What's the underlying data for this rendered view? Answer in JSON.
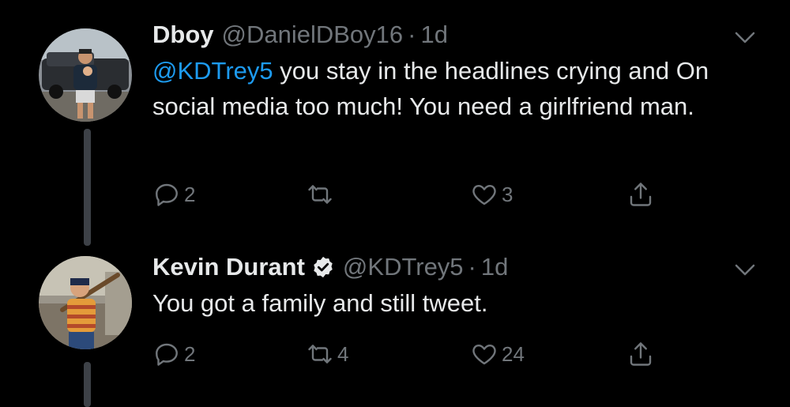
{
  "tweets": [
    {
      "name": "Dboy",
      "handle": "@DanielDBoy16",
      "separator": "·",
      "time": "1d",
      "mention": "@KDTrey5",
      "text": " you stay in the headlines crying and On social media too much! You need a girlfriend man.",
      "avatar_icon": "avatar-man-with-baby-by-truck",
      "counts": {
        "replies": "2",
        "retweets": "",
        "likes": "3"
      }
    },
    {
      "name": "Kevin Durant",
      "verified": true,
      "handle": "@KDTrey5",
      "separator": "·",
      "time": "1d",
      "text": "You got a family and still tweet.",
      "avatar_icon": "avatar-kid-with-baseball-bat",
      "counts": {
        "replies": "2",
        "retweets": "4",
        "likes": "24"
      }
    }
  ],
  "icons": {
    "reply": "reply-icon",
    "retweet": "retweet-icon",
    "like": "heart-icon",
    "share": "share-icon",
    "more": "chevron-down-icon",
    "verified": "verified-badge-icon"
  },
  "colors": {
    "background": "#000000",
    "text": "#e7e9ea",
    "secondary": "#71767b",
    "link": "#1d9bf0",
    "thread_line": "#3d4147"
  }
}
